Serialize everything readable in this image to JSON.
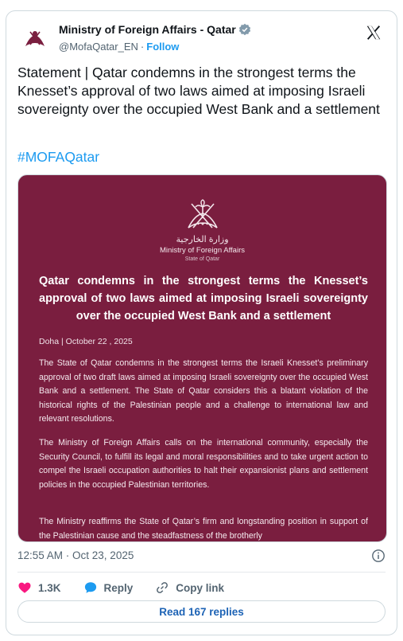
{
  "author": {
    "display_name": "Ministry of Foreign Affairs - Qatar",
    "handle": "@MofaQatar_EN",
    "separator": "·",
    "follow_label": "Follow"
  },
  "tweet": {
    "text": "Statement | Qatar condemns in the strongest terms the Knesset’s approval of two laws aimed at imposing Israeli sovereignty over the occupied West Bank and a settlement",
    "hashtag": "#MOFAQatar"
  },
  "media": {
    "emblem_ar": "وزارة الخارجية",
    "emblem_en": "Ministry of Foreign Affairs",
    "emblem_sub": "State of Qatar",
    "title": "Qatar condemns in the strongest terms the Knesset’s approval of two laws aimed at imposing Israeli sovereignty over the occupied West Bank and a settlement",
    "dateline": "Doha | October 22 , 2025",
    "paragraphs": [
      "The State of Qatar condemns in the strongest terms the Israeli Knesset’s preliminary approval of two draft laws aimed at imposing Israeli sovereignty over the occupied West Bank and a settlement. The State of Qatar considers this a blatant violation of the historical rights of the Palestinian people and a challenge to international law and relevant resolutions.",
      "The Ministry of Foreign Affairs calls on the international community, especially the Security Council, to fulfill its legal and moral responsibilities and to take urgent action to compel the Israeli occupation authorities to halt their expansionist plans and settlement policies in the occupied Palestinian territories.",
      "The Ministry reaffirms the State of Qatar’s firm and longstanding position in support of the Palestinian cause and the steadfastness of the brotherly"
    ]
  },
  "meta": {
    "timestamp": "12:55 AM · Oct 23, 2025"
  },
  "actions": {
    "likes_count": "1.3K",
    "reply_label": "Reply",
    "copy_link_label": "Copy link"
  },
  "replies": {
    "label": "Read 167 replies"
  },
  "icons": {
    "verified": "verified-badge-icon",
    "x_logo": "x-logo-icon",
    "info": "info-icon",
    "heart": "heart-icon",
    "reply": "reply-bubble-icon",
    "link": "link-icon"
  },
  "colors": {
    "accent": "#1d9bf0",
    "media_background": "#7a1e3f",
    "like": "#f91880",
    "reply": "#1d9bf0"
  }
}
